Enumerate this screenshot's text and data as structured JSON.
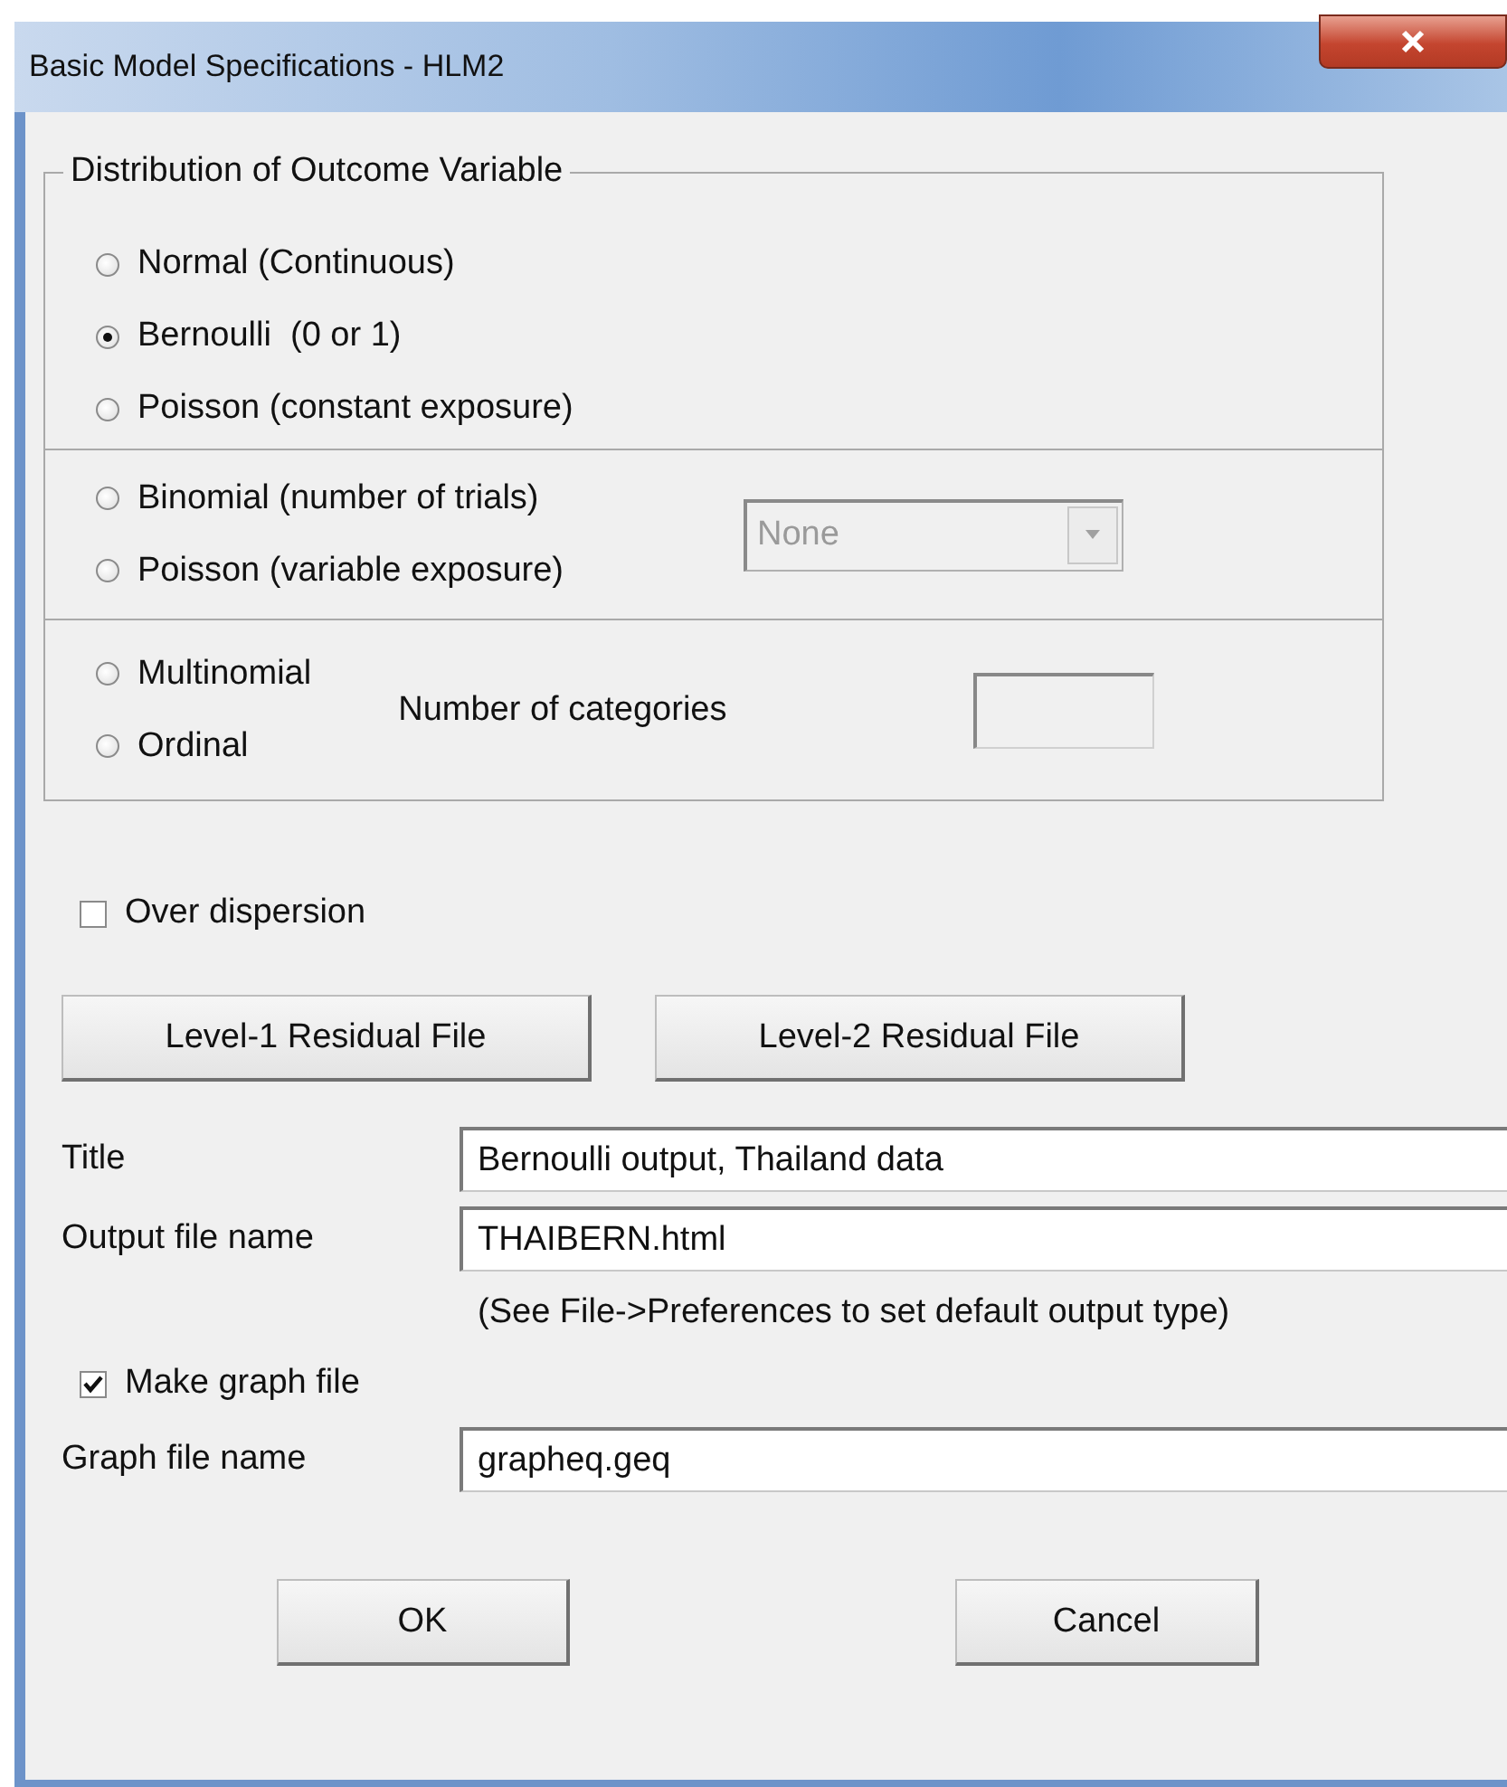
{
  "window": {
    "title": "Basic Model Specifications - HLM2"
  },
  "distribution": {
    "legend": "Distribution of Outcome Variable",
    "sections": [
      {
        "kind": "plain",
        "options": [
          {
            "label": "Normal (Continuous)",
            "selected": false
          },
          {
            "label": "Bernoulli  (0 or 1)",
            "selected": true
          },
          {
            "label": "Poisson (constant exposure)",
            "selected": false
          }
        ]
      },
      {
        "kind": "dropdown",
        "options": [
          {
            "label": "Binomial (number of trials)",
            "selected": false
          },
          {
            "label": "Poisson (variable exposure)",
            "selected": false
          }
        ],
        "dropdown": {
          "value": "None",
          "disabled": true
        }
      },
      {
        "kind": "count",
        "options": [
          {
            "label": "Multinomial",
            "selected": false
          },
          {
            "label": "Ordinal",
            "selected": false
          }
        ],
        "count_label": "Number of categories"
      }
    ]
  },
  "over_dispersion": {
    "label": "Over dispersion",
    "checked": false
  },
  "residual_buttons": [
    "Level-1 Residual File",
    "Level-2 Residual File"
  ],
  "fields": [
    {
      "label": "Title",
      "value": "Bernoulli output, Thailand data"
    },
    {
      "label": "Output file name",
      "value": "THAIBERN.html",
      "note": "(See File->Preferences to set default output type)"
    }
  ],
  "make_graph": {
    "label": "Make graph file",
    "checked": true
  },
  "graph_field": {
    "label": "Graph file name",
    "value": "grapheq.geq"
  },
  "buttons": [
    "OK",
    "Cancel"
  ]
}
